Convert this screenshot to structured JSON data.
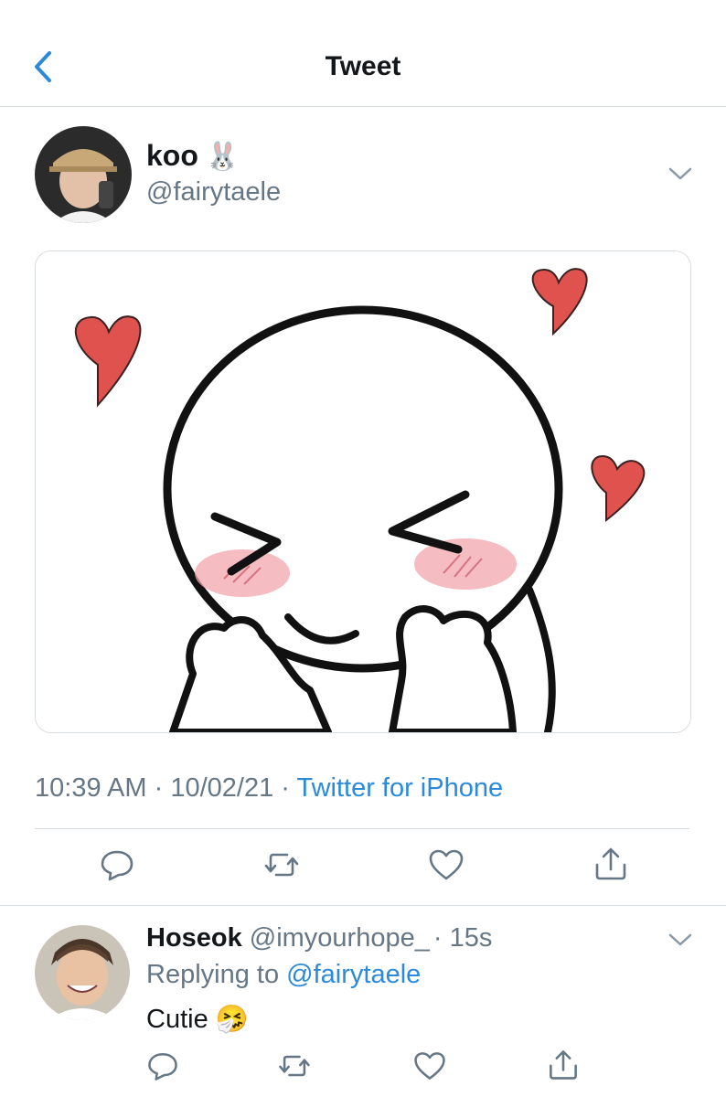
{
  "header": {
    "title": "Tweet",
    "back_icon": "chevron-left-icon"
  },
  "tweet": {
    "author": {
      "name": "koo",
      "emoji": "🐰",
      "handle": "@fairytaele"
    },
    "media": {
      "description_icon": "blushing-face-with-hearts-image"
    },
    "meta": {
      "time": "10:39 AM",
      "sep1": " · ",
      "date": "10/02/21",
      "sep2": " · ",
      "source": "Twitter for iPhone"
    },
    "actions": [
      "reply-icon",
      "retweet-icon",
      "like-icon",
      "share-icon"
    ]
  },
  "reply": {
    "name": "Hoseok",
    "handle": "@imyourhope_",
    "time": "· 15s",
    "replying_prefix": "Replying to ",
    "replying_to": "@fairytaele",
    "text": "Cutie",
    "emoji": "🤧"
  },
  "colors": {
    "link": "#2b8ad9",
    "secondary": "#657786",
    "heart": "#e0524e",
    "divider": "#d7dce0"
  }
}
